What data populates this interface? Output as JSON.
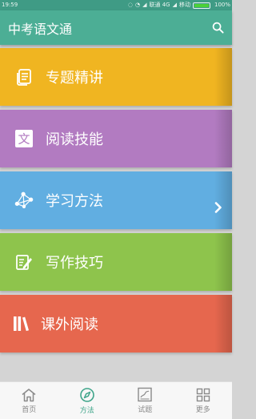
{
  "status_bar": {
    "time": "19:59",
    "carrier1": "联通 4G",
    "carrier2": "移动",
    "battery": "100%",
    "battery_level": 1.0
  },
  "header": {
    "title": "中考语文通",
    "icon": "search-icon"
  },
  "menu": [
    {
      "label": "专题精讲",
      "color": "#f0b521",
      "icon": "topic-book-icon"
    },
    {
      "label": "阅读技能",
      "color": "#b27bc1",
      "icon": "wen-character-icon"
    },
    {
      "label": "学习方法",
      "color": "#61aee1",
      "icon": "network-nodes-icon"
    },
    {
      "label": "写作技巧",
      "color": "#8ec44c",
      "icon": "pen-note-icon"
    },
    {
      "label": "课外阅读",
      "color": "#e6674e",
      "icon": "books-shelf-icon"
    }
  ],
  "bottom_nav": [
    {
      "label": "首页",
      "icon": "home-icon",
      "active": false
    },
    {
      "label": "方法",
      "icon": "compass-icon",
      "active": true
    },
    {
      "label": "试题",
      "icon": "exam-paper-icon",
      "active": false
    },
    {
      "label": "更多",
      "icon": "grid-icon",
      "active": false
    }
  ],
  "colors": {
    "header": "#4cae95",
    "status_bar": "#3f9b85",
    "nav_active": "#3fa58a",
    "nav_inactive": "#8a8a8a"
  }
}
